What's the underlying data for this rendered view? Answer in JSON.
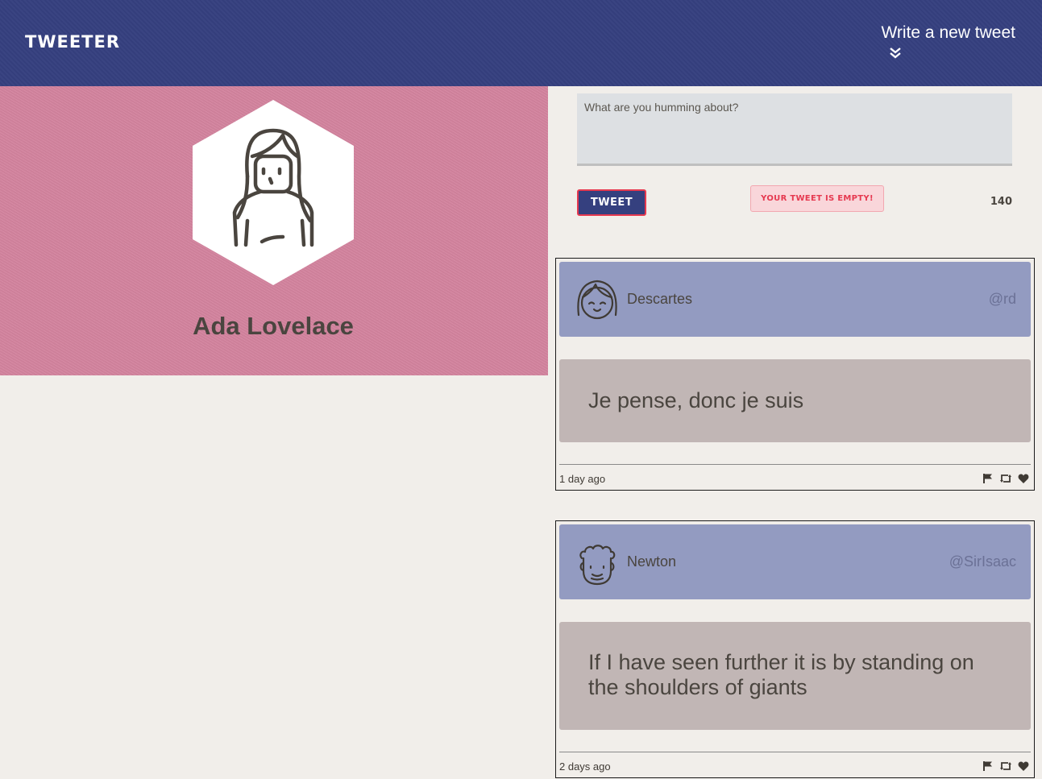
{
  "navbar": {
    "logo": "TWEETER",
    "compose_label": "Write a new tweet",
    "compose_icon": "double-chevron-down-icon",
    "background": "#35407f"
  },
  "profile": {
    "name": "Ada Lovelace",
    "avatar_icon": "woman-long-hair-avatar-icon",
    "background": "#d4849f"
  },
  "composer": {
    "placeholder": "What are you humming about?",
    "value": "",
    "button_label": "TWEET",
    "error": "YOUR TWEET IS EMPTY!",
    "char_count": "140"
  },
  "tweets": [
    {
      "name": "Descartes",
      "handle": "@rd",
      "avatar_icon": "girl-bangs-avatar-icon",
      "content": "Je pense, donc je suis",
      "time": "1 day ago",
      "actions": [
        "flag-icon",
        "retweet-icon",
        "heart-icon"
      ]
    },
    {
      "name": "Newton",
      "handle": "@SirIsaac",
      "avatar_icon": "curly-hair-man-avatar-icon",
      "content": "If I have seen further it is by standing on the shoulders of giants",
      "time": "2 days ago",
      "actions": [
        "flag-icon",
        "retweet-icon",
        "heart-icon"
      ]
    }
  ],
  "colors": {
    "tweet_header": "#939bc1",
    "tweet_body": "#c1b6b5",
    "error": "#e63950",
    "page_bg": "#f1eeea"
  }
}
